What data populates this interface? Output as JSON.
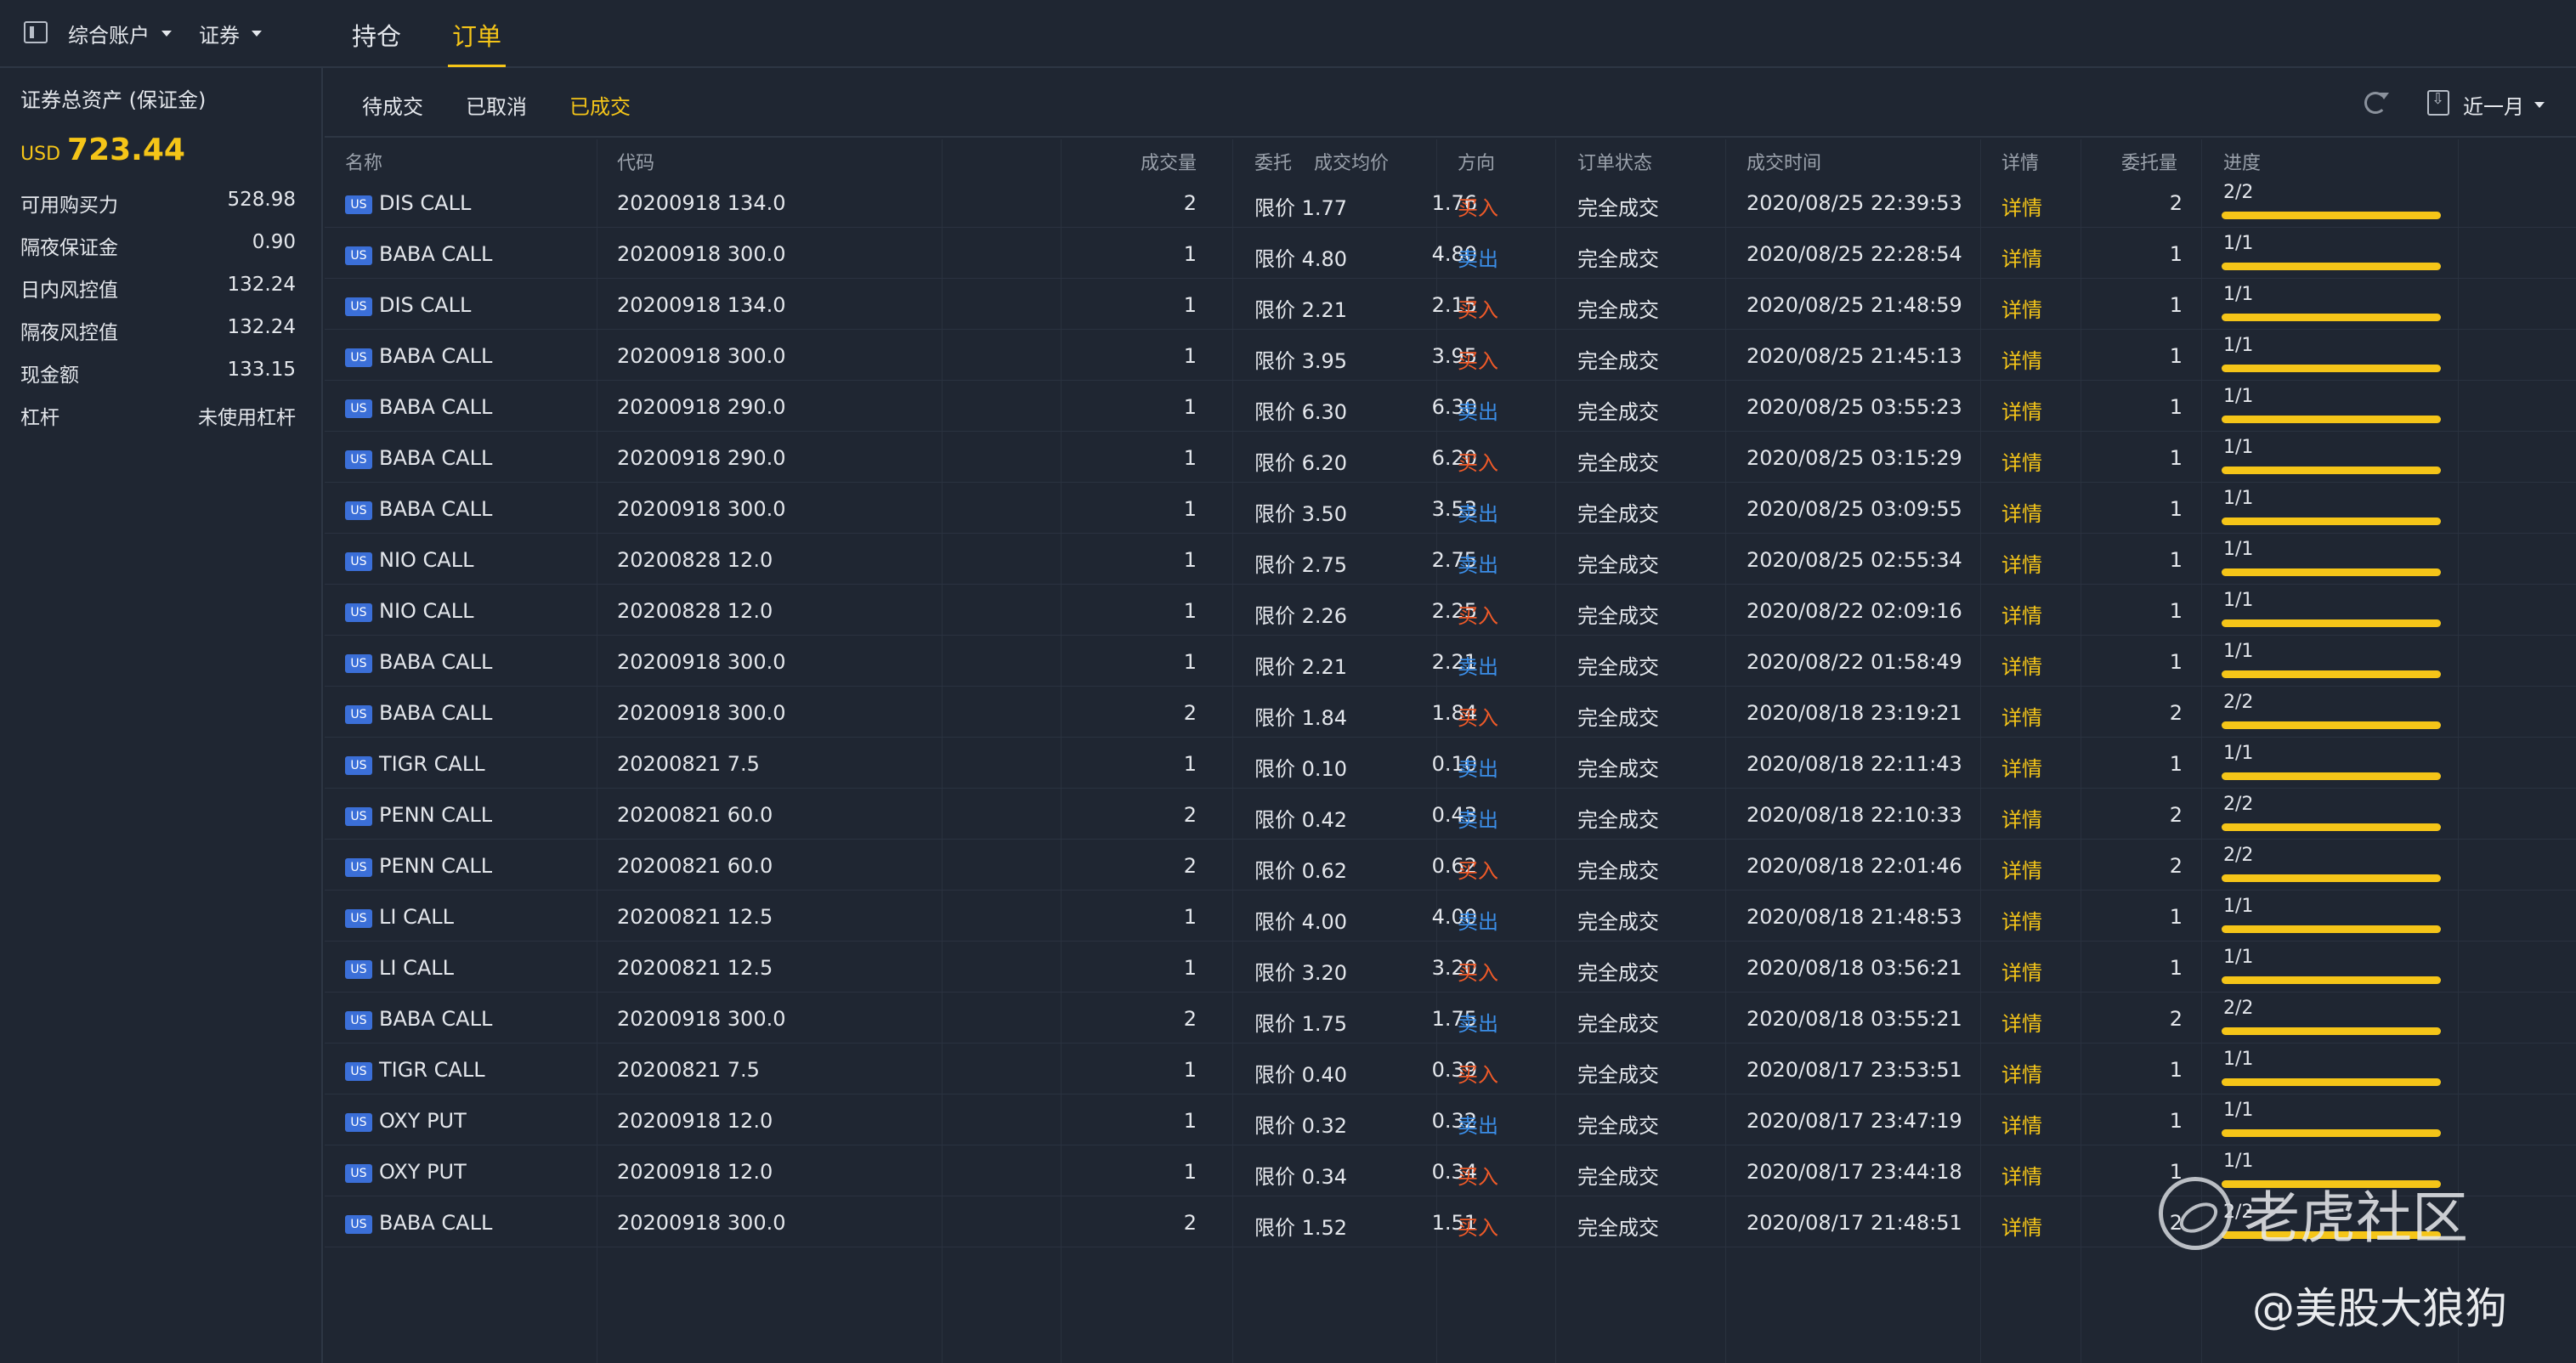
{
  "topbar": {
    "account_label": "综合账户",
    "market_label": "证券",
    "tabs": [
      {
        "label": "持仓",
        "active": false
      },
      {
        "label": "订单",
        "active": true
      }
    ]
  },
  "left_panel": {
    "title": "证券总资产 (保证金)",
    "currency": "USD",
    "total": "723.44",
    "items": [
      {
        "label": "可用购买力",
        "value": "528.98"
      },
      {
        "label": "隔夜保证金",
        "value": "0.90"
      },
      {
        "label": "日内风控值",
        "value": "132.24"
      },
      {
        "label": "隔夜风控值",
        "value": "132.24"
      },
      {
        "label": "现金额",
        "value": "133.15"
      },
      {
        "label": "杠杆",
        "value": "未使用杠杆"
      }
    ]
  },
  "subtabs": [
    {
      "label": "待成交",
      "active": false
    },
    {
      "label": "已取消",
      "active": false
    },
    {
      "label": "已成交",
      "active": true
    }
  ],
  "period": "近一月",
  "columns": {
    "name": "名称",
    "code": "代码",
    "qty": "成交量",
    "avg_price": "成交均价",
    "order": "委托",
    "direction": "方向",
    "status": "订单状态",
    "time": "成交时间",
    "detail": "详情",
    "order_qty": "委托量",
    "progress": "进度"
  },
  "colors": {
    "accent": "#f5c518",
    "buy": "#f05a28",
    "sell": "#3b8ee8",
    "badge": "#3b6fd8"
  },
  "badge_text": "US",
  "rows": [
    {
      "name": "DIS CALL",
      "code": "20200918 134.0",
      "qty": "2",
      "avg": "1.76",
      "order": "限价 1.77",
      "dir": "买入",
      "side": "buy",
      "status": "完全成交",
      "time": "2020/08/25 22:39:53",
      "detail": "详情",
      "oqty": "2",
      "prog": "2/2",
      "fill": 1
    },
    {
      "name": "BABA CALL",
      "code": "20200918 300.0",
      "qty": "1",
      "avg": "4.80",
      "order": "限价 4.80",
      "dir": "卖出",
      "side": "sell",
      "status": "完全成交",
      "time": "2020/08/25 22:28:54",
      "detail": "详情",
      "oqty": "1",
      "prog": "1/1",
      "fill": 1
    },
    {
      "name": "DIS CALL",
      "code": "20200918 134.0",
      "qty": "1",
      "avg": "2.15",
      "order": "限价 2.21",
      "dir": "买入",
      "side": "buy",
      "status": "完全成交",
      "time": "2020/08/25 21:48:59",
      "detail": "详情",
      "oqty": "1",
      "prog": "1/1",
      "fill": 1
    },
    {
      "name": "BABA CALL",
      "code": "20200918 300.0",
      "qty": "1",
      "avg": "3.95",
      "order": "限价 3.95",
      "dir": "买入",
      "side": "buy",
      "status": "完全成交",
      "time": "2020/08/25 21:45:13",
      "detail": "详情",
      "oqty": "1",
      "prog": "1/1",
      "fill": 1
    },
    {
      "name": "BABA CALL",
      "code": "20200918 290.0",
      "qty": "1",
      "avg": "6.30",
      "order": "限价 6.30",
      "dir": "卖出",
      "side": "sell",
      "status": "完全成交",
      "time": "2020/08/25 03:55:23",
      "detail": "详情",
      "oqty": "1",
      "prog": "1/1",
      "fill": 1
    },
    {
      "name": "BABA CALL",
      "code": "20200918 290.0",
      "qty": "1",
      "avg": "6.20",
      "order": "限价 6.20",
      "dir": "买入",
      "side": "buy",
      "status": "完全成交",
      "time": "2020/08/25 03:15:29",
      "detail": "详情",
      "oqty": "1",
      "prog": "1/1",
      "fill": 1
    },
    {
      "name": "BABA CALL",
      "code": "20200918 300.0",
      "qty": "1",
      "avg": "3.53",
      "order": "限价 3.50",
      "dir": "卖出",
      "side": "sell",
      "status": "完全成交",
      "time": "2020/08/25 03:09:55",
      "detail": "详情",
      "oqty": "1",
      "prog": "1/1",
      "fill": 1
    },
    {
      "name": "NIO CALL",
      "code": "20200828 12.0",
      "qty": "1",
      "avg": "2.75",
      "order": "限价 2.75",
      "dir": "卖出",
      "side": "sell",
      "status": "完全成交",
      "time": "2020/08/25 02:55:34",
      "detail": "详情",
      "oqty": "1",
      "prog": "1/1",
      "fill": 1
    },
    {
      "name": "NIO CALL",
      "code": "20200828 12.0",
      "qty": "1",
      "avg": "2.25",
      "order": "限价 2.26",
      "dir": "买入",
      "side": "buy",
      "status": "完全成交",
      "time": "2020/08/22 02:09:16",
      "detail": "详情",
      "oqty": "1",
      "prog": "1/1",
      "fill": 1
    },
    {
      "name": "BABA CALL",
      "code": "20200918 300.0",
      "qty": "1",
      "avg": "2.21",
      "order": "限价 2.21",
      "dir": "卖出",
      "side": "sell",
      "status": "完全成交",
      "time": "2020/08/22 01:58:49",
      "detail": "详情",
      "oqty": "1",
      "prog": "1/1",
      "fill": 1
    },
    {
      "name": "BABA CALL",
      "code": "20200918 300.0",
      "qty": "2",
      "avg": "1.84",
      "order": "限价 1.84",
      "dir": "买入",
      "side": "buy",
      "status": "完全成交",
      "time": "2020/08/18 23:19:21",
      "detail": "详情",
      "oqty": "2",
      "prog": "2/2",
      "fill": 1
    },
    {
      "name": "TIGR CALL",
      "code": "20200821 7.5",
      "qty": "1",
      "avg": "0.10",
      "order": "限价 0.10",
      "dir": "卖出",
      "side": "sell",
      "status": "完全成交",
      "time": "2020/08/18 22:11:43",
      "detail": "详情",
      "oqty": "1",
      "prog": "1/1",
      "fill": 1
    },
    {
      "name": "PENN CALL",
      "code": "20200821 60.0",
      "qty": "2",
      "avg": "0.43",
      "order": "限价 0.42",
      "dir": "卖出",
      "side": "sell",
      "status": "完全成交",
      "time": "2020/08/18 22:10:33",
      "detail": "详情",
      "oqty": "2",
      "prog": "2/2",
      "fill": 1
    },
    {
      "name": "PENN CALL",
      "code": "20200821 60.0",
      "qty": "2",
      "avg": "0.62",
      "order": "限价 0.62",
      "dir": "买入",
      "side": "buy",
      "status": "完全成交",
      "time": "2020/08/18 22:01:46",
      "detail": "详情",
      "oqty": "2",
      "prog": "2/2",
      "fill": 1
    },
    {
      "name": "LI CALL",
      "code": "20200821 12.5",
      "qty": "1",
      "avg": "4.00",
      "order": "限价 4.00",
      "dir": "卖出",
      "side": "sell",
      "status": "完全成交",
      "time": "2020/08/18 21:48:53",
      "detail": "详情",
      "oqty": "1",
      "prog": "1/1",
      "fill": 1
    },
    {
      "name": "LI CALL",
      "code": "20200821 12.5",
      "qty": "1",
      "avg": "3.20",
      "order": "限价 3.20",
      "dir": "买入",
      "side": "buy",
      "status": "完全成交",
      "time": "2020/08/18 03:56:21",
      "detail": "详情",
      "oqty": "1",
      "prog": "1/1",
      "fill": 1
    },
    {
      "name": "BABA CALL",
      "code": "20200918 300.0",
      "qty": "2",
      "avg": "1.75",
      "order": "限价 1.75",
      "dir": "卖出",
      "side": "sell",
      "status": "完全成交",
      "time": "2020/08/18 03:55:21",
      "detail": "详情",
      "oqty": "2",
      "prog": "2/2",
      "fill": 1
    },
    {
      "name": "TIGR CALL",
      "code": "20200821 7.5",
      "qty": "1",
      "avg": "0.39",
      "order": "限价 0.40",
      "dir": "买入",
      "side": "buy",
      "status": "完全成交",
      "time": "2020/08/17 23:53:51",
      "detail": "详情",
      "oqty": "1",
      "prog": "1/1",
      "fill": 1
    },
    {
      "name": "OXY PUT",
      "code": "20200918 12.0",
      "qty": "1",
      "avg": "0.32",
      "order": "限价 0.32",
      "dir": "卖出",
      "side": "sell",
      "status": "完全成交",
      "time": "2020/08/17 23:47:19",
      "detail": "详情",
      "oqty": "1",
      "prog": "1/1",
      "fill": 1
    },
    {
      "name": "OXY PUT",
      "code": "20200918 12.0",
      "qty": "1",
      "avg": "0.34",
      "order": "限价 0.34",
      "dir": "买入",
      "side": "buy",
      "status": "完全成交",
      "time": "2020/08/17 23:44:18",
      "detail": "详情",
      "oqty": "1",
      "prog": "1/1",
      "fill": 1
    },
    {
      "name": "BABA CALL",
      "code": "20200918 300.0",
      "qty": "2",
      "avg": "1.51",
      "order": "限价 1.52",
      "dir": "买入",
      "side": "buy",
      "status": "完全成交",
      "time": "2020/08/17 21:48:51",
      "detail": "详情",
      "oqty": "2",
      "prog": "2/2",
      "fill": 1
    }
  ],
  "watermark": {
    "brand": "老虎社区",
    "user": "@美股大狼狗"
  }
}
